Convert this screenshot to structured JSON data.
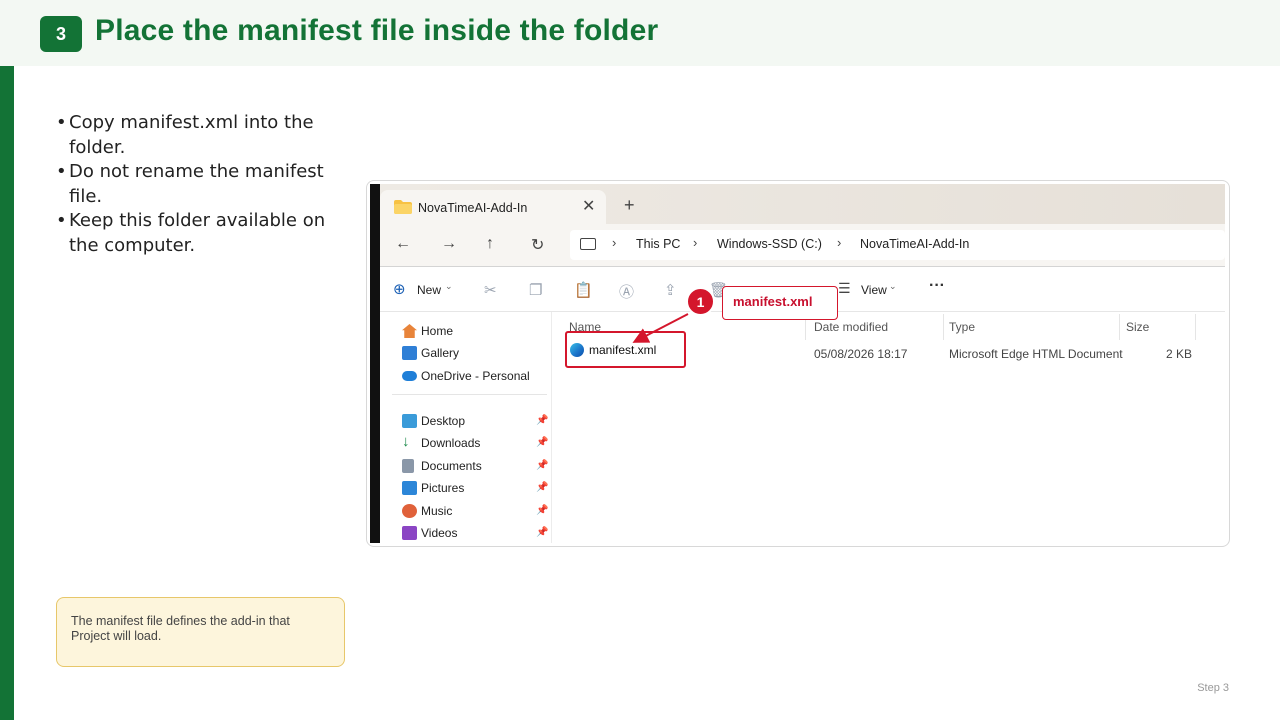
{
  "slide": {
    "step_number": "3",
    "title": "Place the manifest file inside the folder",
    "footer": "Step 3"
  },
  "bullets": [
    "Copy manifest.xml into the folder.",
    "Do not rename the manifest file.",
    "Keep this folder available on the computer."
  ],
  "note": "The manifest file defines the add-in that Project will load.",
  "explorer": {
    "tab_title": "NovaTimeAI-Add-In",
    "breadcrumb": [
      "This PC",
      "Windows-SSD (C:)",
      "NovaTimeAI-Add-In"
    ],
    "commands": {
      "new": "New",
      "view": "View"
    },
    "nav_items": [
      {
        "label": "Home",
        "icon": "home-icon"
      },
      {
        "label": "Gallery",
        "icon": "gallery-icon"
      },
      {
        "label": "OneDrive - Personal",
        "icon": "cloud-icon"
      },
      {
        "label": "Desktop",
        "icon": "desktop-icon",
        "pinned": true
      },
      {
        "label": "Downloads",
        "icon": "download-icon",
        "pinned": true
      },
      {
        "label": "Documents",
        "icon": "document-icon",
        "pinned": true
      },
      {
        "label": "Pictures",
        "icon": "picture-icon",
        "pinned": true
      },
      {
        "label": "Music",
        "icon": "music-icon",
        "pinned": true
      },
      {
        "label": "Videos",
        "icon": "video-icon",
        "pinned": true
      }
    ],
    "columns": [
      "Name",
      "Date modified",
      "Type",
      "Size"
    ],
    "files": [
      {
        "name": "manifest.xml",
        "date": "05/08/2026 18:17",
        "type": "Microsoft Edge HTML Document",
        "size": "2 KB"
      }
    ]
  },
  "callout": {
    "number": "1",
    "label": "manifest.xml",
    "color": "#d4162c"
  },
  "colors": {
    "brand": "#137336",
    "note_bg": "#fdf5dc"
  }
}
